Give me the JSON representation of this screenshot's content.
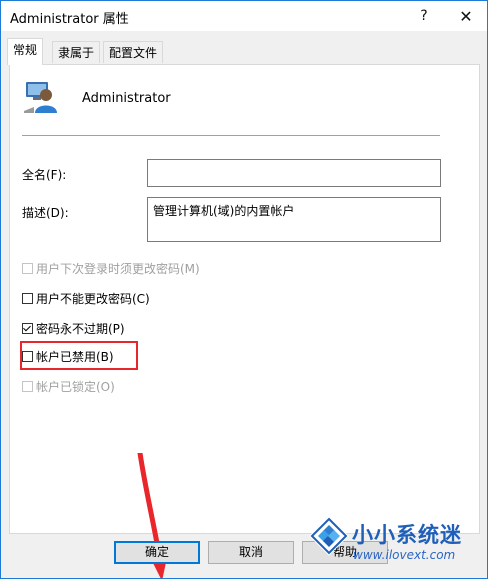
{
  "window": {
    "title": "Administrator 属性",
    "help_glyph": "?",
    "close_glyph": "✕"
  },
  "tabs": [
    {
      "label": "常规",
      "active": true
    },
    {
      "label": "隶属于",
      "active": false
    },
    {
      "label": "配置文件",
      "active": false
    }
  ],
  "user": {
    "name": "Administrator",
    "icon": "user-account-icon"
  },
  "fields": {
    "fullname_label": "全名(F):",
    "fullname_value": "",
    "description_label": "描述(D):",
    "description_value": "管理计算机(域)的内置帐户"
  },
  "checkboxes": [
    {
      "label": "用户下次登录时须更改密码(M)",
      "checked": false,
      "enabled": false
    },
    {
      "label": "用户不能更改密码(C)",
      "checked": false,
      "enabled": true
    },
    {
      "label": "密码永不过期(P)",
      "checked": true,
      "enabled": true
    },
    {
      "label": "帐户已禁用(B)",
      "checked": false,
      "enabled": true
    },
    {
      "label": "帐户已锁定(O)",
      "checked": false,
      "enabled": false
    }
  ],
  "buttons": {
    "ok": "确定",
    "cancel": "取消",
    "help": "帮助"
  },
  "watermark": {
    "title": "小小系统迷",
    "url": "www.ilovext.com"
  },
  "colors": {
    "accent": "#0078d7",
    "highlight": "#e8262b"
  }
}
